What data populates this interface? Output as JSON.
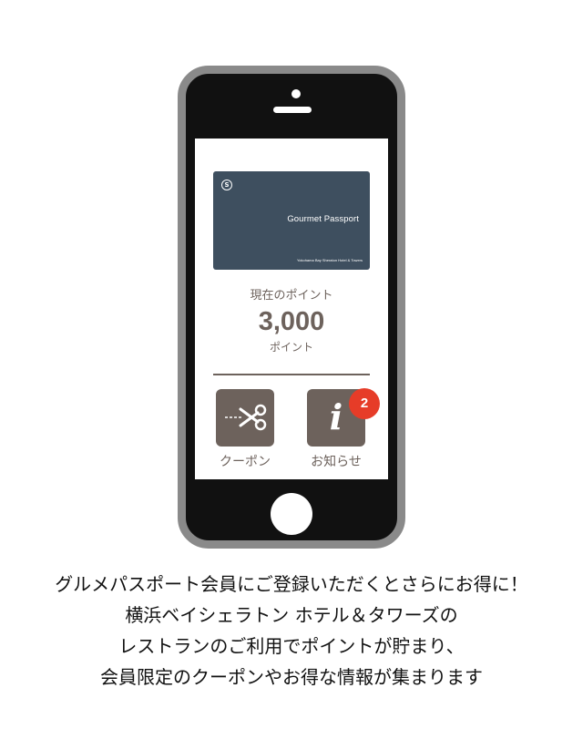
{
  "card": {
    "logo": "S",
    "title": "Gourmet Passport",
    "subtitle": "Yokohama Bay Sheraton Hotel & Towers"
  },
  "points": {
    "label": "現在のポイント",
    "value": "3,000",
    "unit": "ポイント"
  },
  "actions": {
    "coupon_label": "クーポン",
    "info_label": "お知らせ",
    "info_glyph": "i",
    "info_badge": "2"
  },
  "caption": {
    "lines": [
      "グルメパスポート会員にご登録いただくとさらにお得に！",
      "横浜ベイシェラトン ホテル＆タワーズの",
      "レストランのご利用でポイントが貯まり、",
      "会員限定のクーポンやお得な情報が集まります"
    ]
  },
  "colors": {
    "card_bg": "#3e4f5f",
    "accent_brown": "#6d625c",
    "badge_red": "#e63c28",
    "phone_frame": "#8a8a8a",
    "phone_body": "#111111"
  },
  "icons": {
    "coupon": "scissors-icon",
    "info": "info-icon"
  }
}
